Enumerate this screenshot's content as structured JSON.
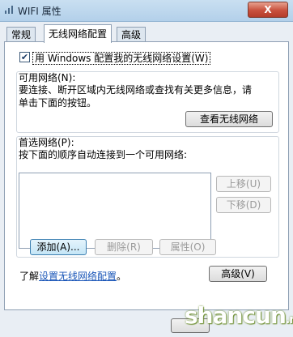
{
  "window": {
    "title": "WIFI 属性",
    "close_label": "X"
  },
  "tabs": [
    {
      "label": "常规"
    },
    {
      "label": "无线网络配置"
    },
    {
      "label": "高级"
    }
  ],
  "wireless": {
    "use_windows_label": "用 Windows 配置我的无线网络设置(W)",
    "use_windows_checked": true,
    "available": {
      "title": "可用网络(N):",
      "desc_line1": "要连接、断开区域内无线网络或查找有关更多信息，请",
      "desc_line2": "单击下面的按钮。",
      "view_button": "查看无线网络"
    },
    "preferred": {
      "title": "首选网络(P):",
      "desc": "按下面的顺序自动连接到一个可用网络:",
      "move_up": "上移(U)",
      "move_down": "下移(D)",
      "add": "添加(A)...",
      "delete": "删除(R)",
      "properties": "属性(O)"
    },
    "learn_prefix": "了解",
    "learn_link": "设置无线网络配置",
    "learn_suffix": "。",
    "advanced_button": "高级(V)"
  },
  "watermark": {
    "text": "shancun",
    "suffix": ".net"
  },
  "colors": {
    "highlight": "#f5f532",
    "link": "#1a56b8"
  }
}
